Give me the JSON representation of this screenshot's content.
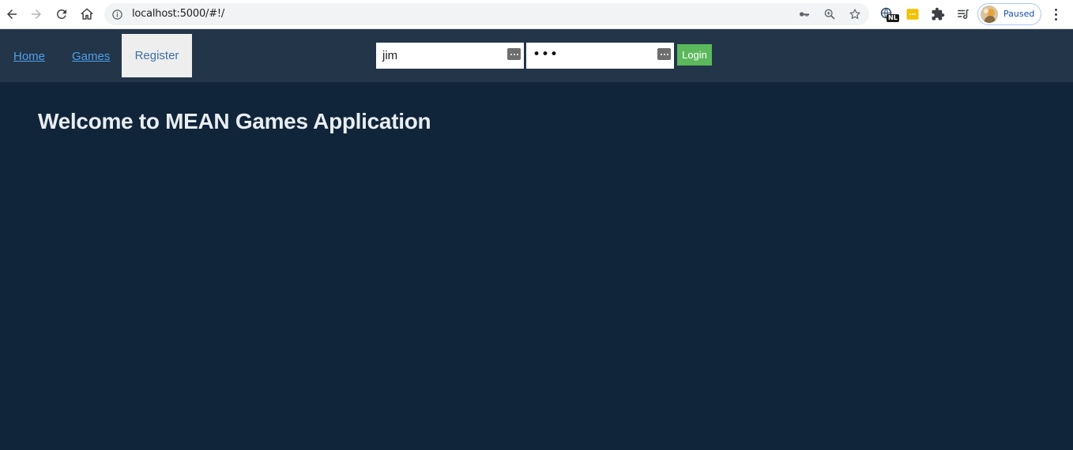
{
  "browser": {
    "url": "localhost:5000/#!/",
    "profile_label": "Paused",
    "extension_badge": "NL"
  },
  "navbar": {
    "links": [
      {
        "label": "Home"
      },
      {
        "label": "Games"
      },
      {
        "label": "Register"
      }
    ],
    "login": {
      "username_value": "jim",
      "password_mask": "•••",
      "login_label": "Login"
    }
  },
  "main": {
    "title": "Welcome to MEAN Games Application"
  },
  "colors": {
    "navbar_bg": "#233549",
    "page_bg": "#10243a",
    "link": "#4f9fe6",
    "login_button": "#5cb85c"
  }
}
